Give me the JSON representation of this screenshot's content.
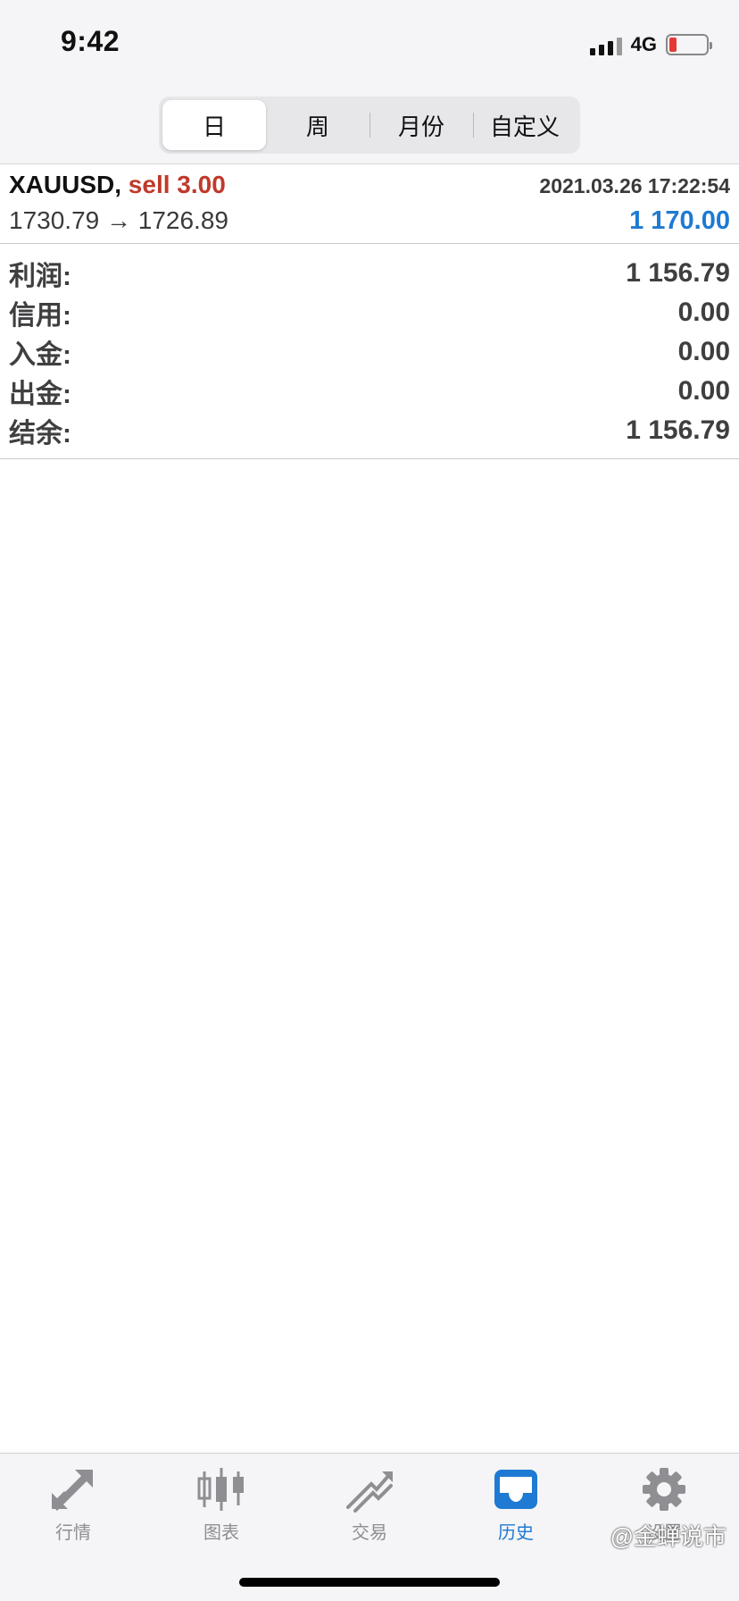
{
  "status_bar": {
    "time": "9:42",
    "network": "4G"
  },
  "segments": [
    {
      "label": "日",
      "active": true
    },
    {
      "label": "周",
      "active": false
    },
    {
      "label": "月份",
      "active": false
    },
    {
      "label": "自定义",
      "active": false
    }
  ],
  "deal": {
    "symbol": "XAUUSD,",
    "side": "sell 3.00",
    "time": "2021.03.26 17:22:54",
    "prices": "1730.79 → 1726.89",
    "profit": "1 170.00"
  },
  "summary": [
    {
      "label": "利润:",
      "value": "1 156.79"
    },
    {
      "label": "信用:",
      "value": "0.00"
    },
    {
      "label": "入金:",
      "value": "0.00"
    },
    {
      "label": "出金:",
      "value": "0.00"
    },
    {
      "label": "结余:",
      "value": "1 156.79"
    }
  ],
  "tabs": [
    {
      "label": "行情",
      "icon": "quotes-icon",
      "active": false
    },
    {
      "label": "图表",
      "icon": "chart-icon",
      "active": false
    },
    {
      "label": "交易",
      "icon": "trade-icon",
      "active": false
    },
    {
      "label": "历史",
      "icon": "history-icon",
      "active": true
    },
    {
      "label": "设置",
      "icon": "settings-icon",
      "active": false
    }
  ],
  "watermark": "@金蝉说市",
  "colors": {
    "accent": "#1e7ad3",
    "sell": "#c0392b",
    "battery_low": "#e53935"
  }
}
